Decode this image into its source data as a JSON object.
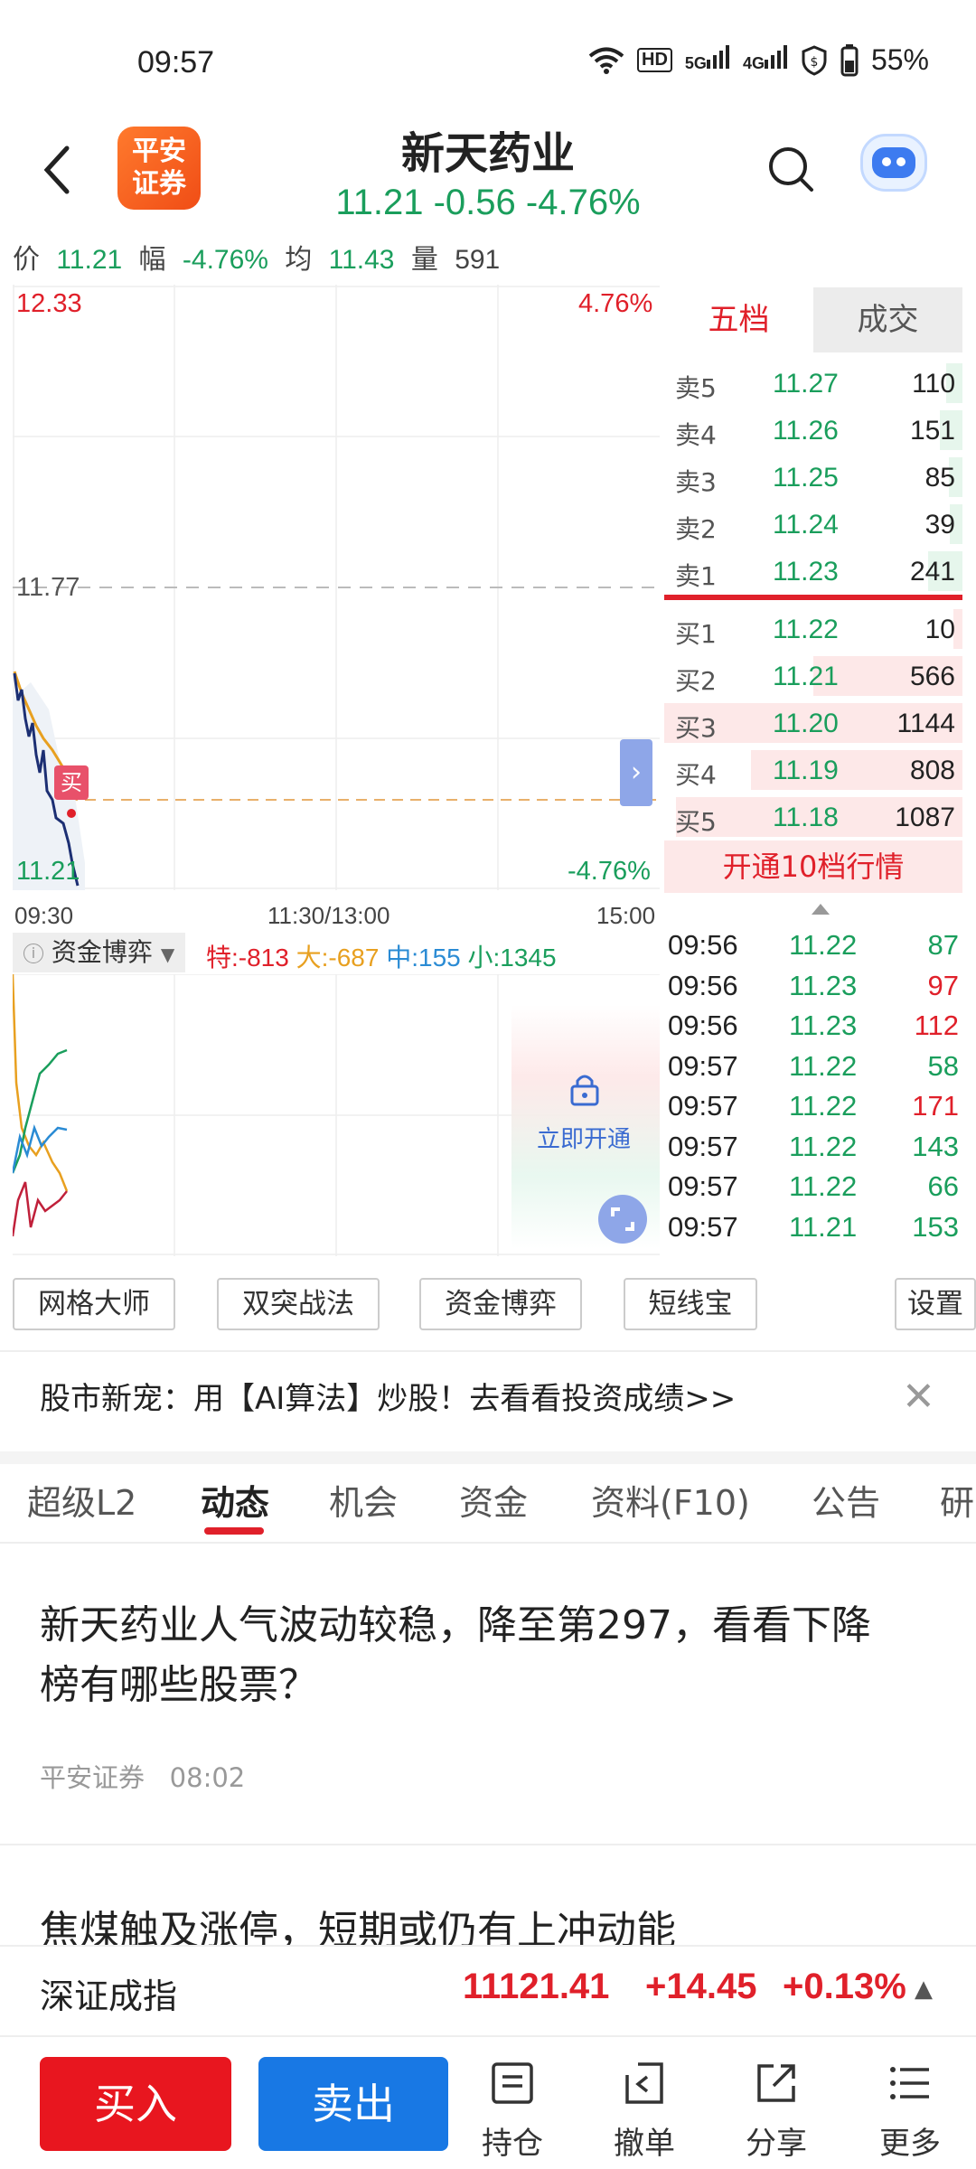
{
  "status_bar": {
    "time": "09:57",
    "hd": "HD",
    "net1": "5G",
    "net2": "4G",
    "battery": "55%"
  },
  "header": {
    "logo_text_line1": "平安",
    "logo_text_line2": "证券",
    "stock_name": "新天药业",
    "quote": "11.21  -0.56  -4.76%"
  },
  "info_line": {
    "price_label": "价",
    "price": "11.21",
    "range_label": "幅",
    "range": "-4.76%",
    "avg_label": "均",
    "avg": "11.43",
    "vol_label": "量",
    "vol": "591"
  },
  "chart": {
    "high_price": "12.33",
    "high_pct": "4.76%",
    "mid_price": "11.77",
    "low_price": "11.21",
    "low_pct": "-4.76%",
    "time_open": "09:30",
    "time_mid": "11:30/13:00",
    "time_close": "15:00",
    "buy_marker": "买",
    "expand_glyph": "›"
  },
  "order_book": {
    "tab_five": "五档",
    "tab_trades": "成交",
    "sells": [
      {
        "label": "卖5",
        "price": "11.27",
        "vol": "110",
        "bar": 0.07
      },
      {
        "label": "卖4",
        "price": "11.26",
        "vol": "151",
        "bar": 0.1
      },
      {
        "label": "卖3",
        "price": "11.25",
        "vol": "85",
        "bar": 0.06
      },
      {
        "label": "卖2",
        "price": "11.24",
        "vol": "39",
        "bar": 0.03
      },
      {
        "label": "卖1",
        "price": "11.23",
        "vol": "241",
        "bar": 0.15
      }
    ],
    "buys": [
      {
        "label": "买1",
        "price": "11.22",
        "vol": "10",
        "bar": 0.01
      },
      {
        "label": "买2",
        "price": "11.21",
        "vol": "566",
        "bar": 0.5
      },
      {
        "label": "买3",
        "price": "11.20",
        "vol": "1144",
        "bar": 1.0
      },
      {
        "label": "买4",
        "price": "11.19",
        "vol": "808",
        "bar": 0.71
      },
      {
        "label": "买5",
        "price": "11.18",
        "vol": "1087",
        "bar": 0.96
      }
    ],
    "open_ten": "开通10档行情"
  },
  "trades": [
    {
      "time": "09:56",
      "price": "11.22",
      "vol": "87",
      "dir": "down"
    },
    {
      "time": "09:56",
      "price": "11.23",
      "vol": "97",
      "dir": "up"
    },
    {
      "time": "09:56",
      "price": "11.23",
      "vol": "112",
      "dir": "up"
    },
    {
      "time": "09:57",
      "price": "11.22",
      "vol": "58",
      "dir": "down"
    },
    {
      "time": "09:57",
      "price": "11.22",
      "vol": "171",
      "dir": "up"
    },
    {
      "time": "09:57",
      "price": "11.22",
      "vol": "143",
      "dir": "down"
    },
    {
      "time": "09:57",
      "price": "11.22",
      "vol": "66",
      "dir": "down"
    },
    {
      "time": "09:57",
      "price": "11.21",
      "vol": "153",
      "dir": "down"
    }
  ],
  "fund_game": {
    "info_glyph": "i",
    "tab": "资金博弈",
    "dropdown_glyph": "▼",
    "te": "特:-813",
    "da": "大:-687",
    "zhong": "中:155",
    "xiao": "小:1345",
    "unlock": "立即开通"
  },
  "strategies": [
    "网格大师",
    "双突战法",
    "资金博弈",
    "短线宝",
    "设置"
  ],
  "banner": {
    "text": "股市新宠：用【AI算法】炒股！去看看投资成绩>>",
    "close": "✕"
  },
  "news_tabs": [
    "超级L2",
    "动态",
    "机会",
    "资金",
    "资料(F10)",
    "公告",
    "研"
  ],
  "news": [
    {
      "title": "新天药业人气波动较稳，降至第297，看看下降榜有哪些股票？",
      "source": "平安证券",
      "time": "08:02"
    },
    {
      "title": "焦煤触及涨停，短期或仍有上冲动能"
    }
  ],
  "index_bar": {
    "name": "深证成指",
    "value": "11121.41",
    "change": "+14.45",
    "pct": "+0.13%",
    "arrow": "▲"
  },
  "bottom": {
    "buy": "买入",
    "sell": "卖出",
    "hold": "持仓",
    "cancel": "撤单",
    "share": "分享",
    "more": "更多"
  },
  "colors": {
    "up": "#e0202a",
    "down": "#1a9e5c",
    "price_line": "#1c2f73",
    "avg_line": "#e8a020"
  }
}
